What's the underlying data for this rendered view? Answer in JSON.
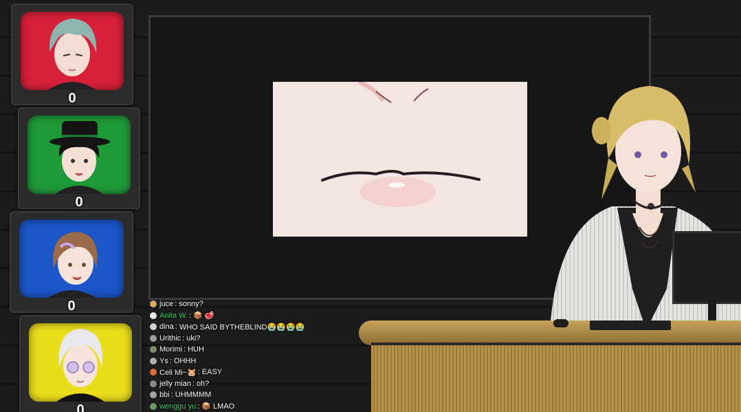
{
  "contestants": [
    {
      "name": "contestant-red",
      "color": "#d8203a",
      "score": "0"
    },
    {
      "name": "contestant-green",
      "color": "#1f9a38",
      "score": "0"
    },
    {
      "name": "contestant-blue",
      "color": "#1c56c8",
      "score": "0"
    },
    {
      "name": "contestant-yellow",
      "color": "#e9dd1c",
      "score": "0"
    }
  ],
  "chat": [
    {
      "user": "juce",
      "sep": ":",
      "message": "sonny?",
      "color": "#ffffff"
    },
    {
      "user": "Anita W.",
      "sep": ":",
      "message": "📦 🥩",
      "color": "#3dd16a"
    },
    {
      "user": "dina",
      "sep": ":",
      "message": "WHO SAID BYTHEBLIND😭😭😭😭",
      "color": "#ffffff"
    },
    {
      "user": "Urithic",
      "sep": ":",
      "message": "uki?",
      "color": "#ffffff"
    },
    {
      "user": "Morimi",
      "sep": ":",
      "message": "HUH",
      "color": "#ffffff"
    },
    {
      "user": "Ys",
      "sep": ":",
      "message": "OHHH",
      "color": "#ffffff"
    },
    {
      "user": "Celi Mi~🐹",
      "sep": ":",
      "message": "EASY",
      "color": "#ffffff"
    },
    {
      "user": "jelly mian",
      "sep": ":",
      "message": "oh?",
      "color": "#ffffff"
    },
    {
      "user": "bbi",
      "sep": ":",
      "message": "UHMMMM",
      "color": "#ffffff"
    },
    {
      "user": "wenggu yu",
      "sep": ":",
      "message": "📦 LMAO",
      "color": "#3dd16a"
    }
  ]
}
